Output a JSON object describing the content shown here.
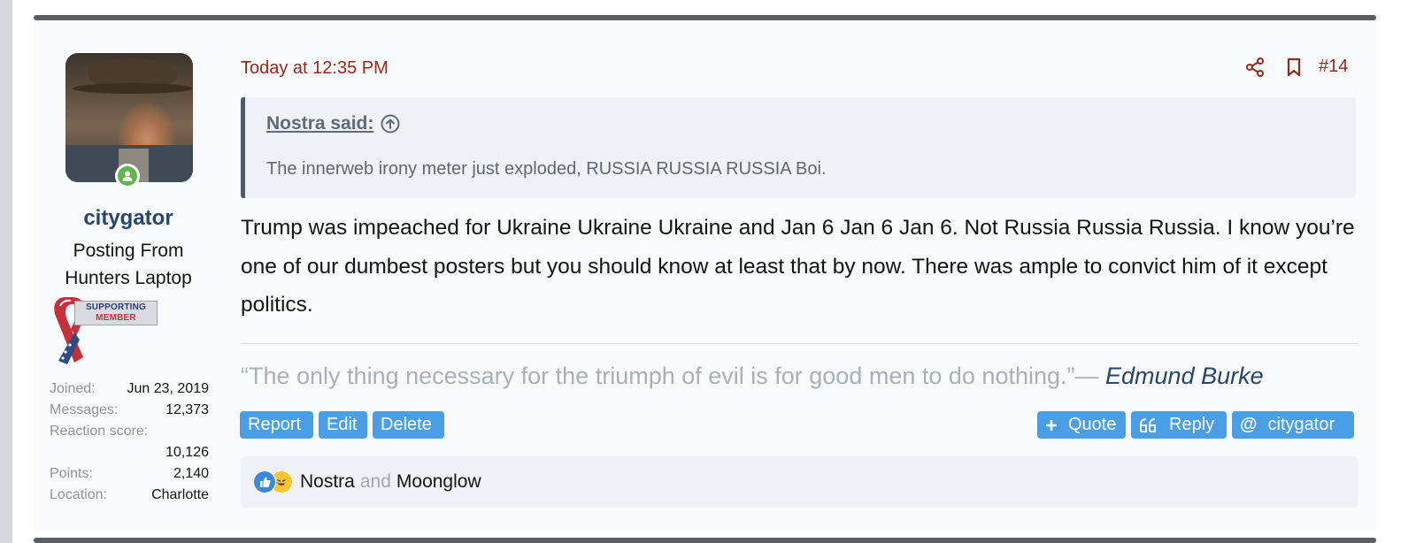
{
  "post": {
    "date": "Today at 12:35 PM",
    "number": "#14",
    "quote": {
      "author": "Nostra said:",
      "text": "The innerweb irony meter just exploded, RUSSIA RUSSIA RUSSIA Boi."
    },
    "message": "Trump was impeached for Ukraine Ukraine Ukraine and Jan 6 Jan 6 Jan 6. Not Russia Russia Russia. I know you’re one of our dumbest posters but you should know at least that by now. There was ample to convict him of it except politics.",
    "signature": {
      "quote": "“The only thing necessary for the triumph of evil is for good men to do nothing.”",
      "dash": "— ",
      "author": "Edmund Burke"
    }
  },
  "user": {
    "name": "citygator",
    "title_line1": "Posting From",
    "title_line2": "Hunters Laptop",
    "badge_line1": "SUPPORTING",
    "badge_line2": "MEMBER",
    "stats": {
      "joined_label": "Joined:",
      "joined_value": "Jun 23, 2019",
      "messages_label": "Messages:",
      "messages_value": "12,373",
      "reaction_label": "Reaction score:",
      "reaction_value": "10,126",
      "points_label": "Points:",
      "points_value": "2,140",
      "location_label": "Location:",
      "location_value": "Charlotte"
    }
  },
  "actions": {
    "report": "Report",
    "edit": "Edit",
    "delete": "Delete",
    "quote": "Quote",
    "reply": "Reply",
    "mention": "citygator"
  },
  "reactions": {
    "icons": [
      "like-icon",
      "laugh-icon"
    ],
    "user1": "Nostra",
    "and": "and",
    "user2": "Moonglow"
  },
  "icons": [
    "share-icon",
    "bookmark-icon",
    "quote-arrow-up-icon",
    "online-status-icon",
    "ribbon-icon",
    "plus-icon",
    "reply-quote-icon",
    "at-icon"
  ],
  "colors": {
    "accent_red": "#8f2b1c",
    "button_blue": "#4a9ee6",
    "username_navy": "#27466a",
    "online_green": "#63b34f"
  }
}
